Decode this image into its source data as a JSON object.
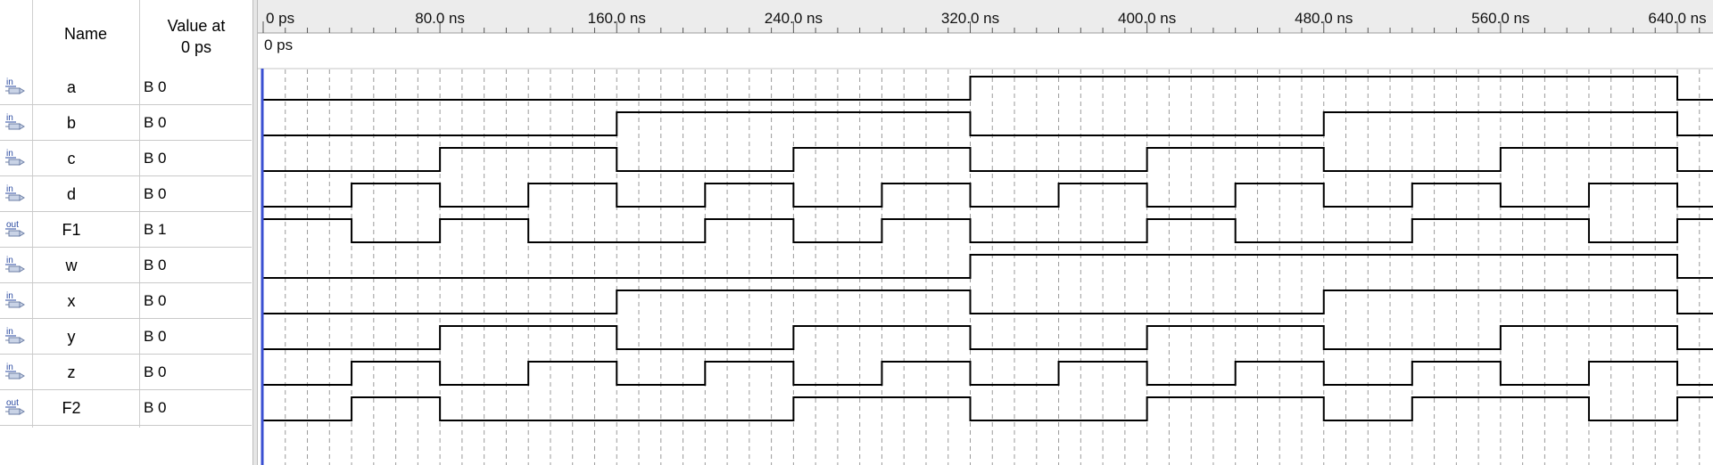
{
  "header": {
    "name_col": "Name",
    "value_col_line1": "Value at",
    "value_col_line2": "0 ps"
  },
  "timebar": {
    "cursor_label": "0 ps",
    "ticks": [
      "0 ps",
      "80.0 ns",
      "160.0 ns",
      "240.0 ns",
      "320.0 ns",
      "400.0 ns",
      "480.0 ns",
      "560.0 ns",
      "640.0 ns"
    ]
  },
  "signals": [
    {
      "direction": "in",
      "direction_label": "in",
      "name": "a",
      "value": "B 0",
      "transitions_ns": [
        0,
        320,
        640
      ],
      "initial": 0
    },
    {
      "direction": "in",
      "direction_label": "in",
      "name": "b",
      "value": "B 0",
      "transitions_ns": [
        0,
        160,
        320,
        480,
        640
      ],
      "initial": 0
    },
    {
      "direction": "in",
      "direction_label": "in",
      "name": "c",
      "value": "B 0",
      "transitions_ns": [
        0,
        80,
        160,
        240,
        320,
        400,
        480,
        560,
        640
      ],
      "initial": 0
    },
    {
      "direction": "in",
      "direction_label": "in",
      "name": "d",
      "value": "B 0",
      "transitions_ns": [
        0,
        40,
        80,
        120,
        160,
        200,
        240,
        280,
        320,
        360,
        400,
        440,
        480,
        520,
        560,
        600,
        640
      ],
      "initial": 0
    },
    {
      "direction": "out",
      "direction_label": "out",
      "name": "F1",
      "value": "B 1",
      "levels": [
        1,
        0,
        1,
        0,
        0,
        1,
        0,
        1,
        0,
        0,
        1,
        0,
        0,
        1,
        1,
        0,
        1
      ],
      "initial": 1
    },
    {
      "direction": "in",
      "direction_label": "in",
      "name": "w",
      "value": "B 0",
      "transitions_ns": [
        0,
        320,
        640
      ],
      "initial": 0
    },
    {
      "direction": "in",
      "direction_label": "in",
      "name": "x",
      "value": "B 0",
      "transitions_ns": [
        0,
        160,
        320,
        480,
        640
      ],
      "initial": 0
    },
    {
      "direction": "in",
      "direction_label": "in",
      "name": "y",
      "value": "B 0",
      "transitions_ns": [
        0,
        80,
        160,
        240,
        320,
        400,
        480,
        560,
        640
      ],
      "initial": 0
    },
    {
      "direction": "in",
      "direction_label": "in",
      "name": "z",
      "value": "B 0",
      "transitions_ns": [
        0,
        40,
        80,
        120,
        160,
        200,
        240,
        280,
        320,
        360,
        400,
        440,
        480,
        520,
        560,
        600,
        640
      ],
      "initial": 0
    },
    {
      "direction": "out",
      "direction_label": "out",
      "name": "F2",
      "value": "B 0",
      "levels": [
        0,
        1,
        0,
        0,
        0,
        0,
        1,
        1,
        0,
        0,
        1,
        1,
        0,
        1,
        1,
        0,
        1
      ],
      "initial": 0
    }
  ],
  "colors": {
    "cursor": "#3a4fd1",
    "grid": "#9a9a9a",
    "wave": "#000000",
    "timebar_bg": "#ececec"
  }
}
